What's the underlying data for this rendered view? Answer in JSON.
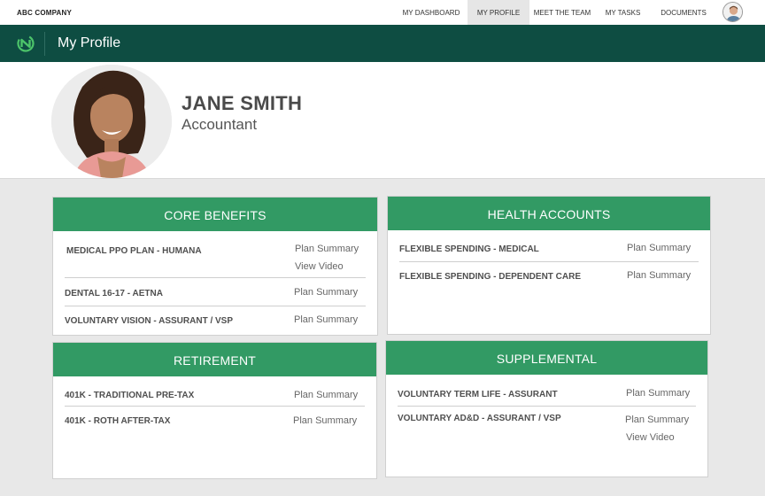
{
  "company": "ABC COMPANY",
  "nav": {
    "items": [
      {
        "label": "MY DASHBOARD",
        "active": false
      },
      {
        "label": "MY PROFILE",
        "active": true
      },
      {
        "label": "MEET THE TEAM",
        "active": false
      },
      {
        "label": "MY TASKS",
        "active": false
      },
      {
        "label": "DOCUMENTS",
        "active": false
      }
    ]
  },
  "header": {
    "title": "My Profile"
  },
  "profile": {
    "name": "JANE SMITH",
    "title": "Accountant"
  },
  "colors": {
    "nav_dark": "#0e4d42",
    "card_header": "#329a64",
    "logo": "#4cc46a"
  },
  "cards": {
    "core": {
      "title": "CORE BENEFITS",
      "rows": [
        {
          "label": "MEDICAL PPO PLAN - HUMANA",
          "link1": "Plan Summary",
          "link2": "View Video"
        },
        {
          "label": "DENTAL 16-17 - AETNA",
          "link1": "Plan Summary"
        },
        {
          "label": "VOLUNTARY VISION - ASSURANT / VSP",
          "link1": "Plan Summary"
        }
      ]
    },
    "health": {
      "title": "HEALTH ACCOUNTS",
      "rows": [
        {
          "label": "FLEXIBLE SPENDING - MEDICAL",
          "link1": "Plan Summary"
        },
        {
          "label": "FLEXIBLE SPENDING - DEPENDENT CARE",
          "link1": "Plan Summary"
        }
      ]
    },
    "retirement": {
      "title": "RETIREMENT",
      "rows": [
        {
          "label": "401K - TRADITIONAL PRE-TAX",
          "link1": "Plan Summary"
        },
        {
          "label": "401K - ROTH AFTER-TAX",
          "link1": "Plan Summary"
        }
      ]
    },
    "supplemental": {
      "title": "SUPPLEMENTAL",
      "rows": [
        {
          "label": "VOLUNTARY TERM LIFE - ASSURANT",
          "link1": "Plan Summary"
        },
        {
          "label": "VOLUNTARY AD&D - ASSURANT / VSP",
          "link1": "Plan Summary",
          "link2": "View Video"
        }
      ]
    }
  }
}
